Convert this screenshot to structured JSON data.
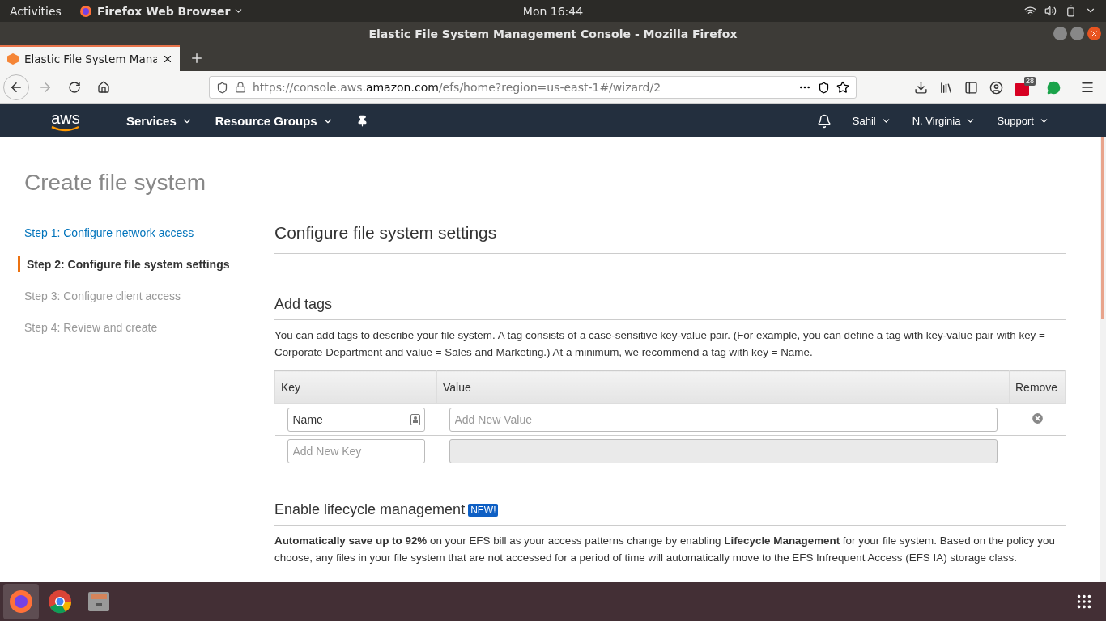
{
  "system_bar": {
    "activities": "Activities",
    "app_menu": "Firefox Web Browser",
    "clock": "Mon 16:44"
  },
  "window": {
    "title": "Elastic File System Management Console - Mozilla Firefox"
  },
  "tabs": [
    {
      "label": "Elastic File System Mana",
      "selected": true
    }
  ],
  "address": {
    "url_prefix": "https://console.aws.",
    "url_domain": "amazon.com",
    "url_suffix": "/efs/home?region=us-east-1#/wizard/2"
  },
  "toolbar": {
    "extension_badge": "28"
  },
  "aws_nav": {
    "logo": "aws",
    "menus": [
      "Services",
      "Resource Groups"
    ],
    "right_menus": [
      "Sahil",
      "N. Virginia",
      "Support"
    ]
  },
  "page_title": "Create file system",
  "steps": [
    {
      "label": "Step 1: Configure network access",
      "selected": false,
      "disabled": false
    },
    {
      "label": "Step 2: Configure file system settings",
      "selected": true,
      "disabled": false
    },
    {
      "label": "Step 3: Configure client access",
      "selected": false,
      "disabled": true
    },
    {
      "label": "Step 4: Review and create",
      "selected": false,
      "disabled": true
    }
  ],
  "section_title": "Configure file system settings",
  "tags": {
    "heading": "Add tags",
    "description": "You can add tags to describe your file system. A tag consists of a case-sensitive key-value pair. (For example, you can define a tag with key-value pair with key = Corporate Department and value = Sales and Marketing.) At a minimum, we recommend a tag with key = Name.",
    "columns": [
      "Key",
      "Value",
      "Remove"
    ],
    "rows": [
      {
        "key": {
          "value": "Name"
        },
        "value": {
          "placeholder": "Add New Value",
          "disabled": false
        },
        "removable": true
      },
      {
        "key": {
          "placeholder": "Add New Key"
        },
        "value": {
          "disabled": true
        },
        "removable": false
      }
    ]
  },
  "lifecycle": {
    "heading": "Enable lifecycle management",
    "badge": "NEW!",
    "text": "**Automatically save up to 92%** on your EFS bill as your access patterns change by enabling **Lifecycle Management** for your file system. Based on the policy you choose, any files in your file system that are not accessed for a period of time will automatically move to the EFS Infrequent Access (EFS IA) storage class."
  }
}
